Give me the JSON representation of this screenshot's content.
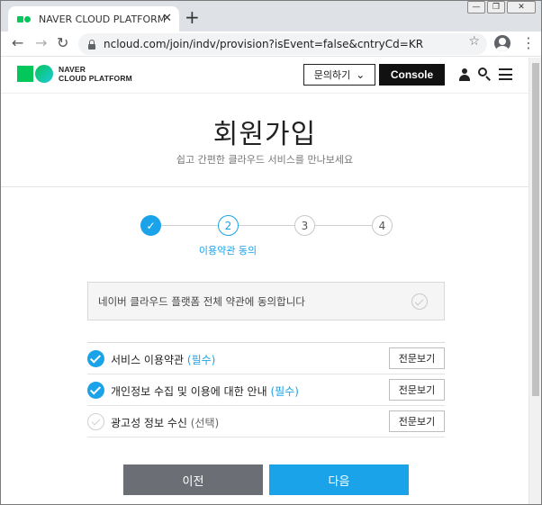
{
  "browser": {
    "tab_title": "NAVER CLOUD PLATFORM 네이",
    "tab_close": "✕",
    "new_tab": "+",
    "url": "ncloud.com/join/indv/provision?isEvent=false&cntryCd=KR",
    "back": "←",
    "forward": "→",
    "reload": "↻",
    "star": "☆",
    "menu": "⋮",
    "window_controls": [
      "—",
      "❐",
      "✕"
    ]
  },
  "header": {
    "logo_line1": "NAVER",
    "logo_line2": "CLOUD PLATFORM",
    "inquiry_label": "문의하기",
    "inquiry_chevron": "⌄",
    "console_label": "Console"
  },
  "page": {
    "title": "회원가입",
    "subtitle": "쉽고 간편한 클라우드 서비스를 만나보세요"
  },
  "stepper": {
    "steps": [
      {
        "label": "✓",
        "state": "done"
      },
      {
        "label": "2",
        "state": "active"
      },
      {
        "label": "3",
        "state": "todo"
      },
      {
        "label": "4",
        "state": "todo"
      }
    ],
    "current_step_label": "이용약관 동의"
  },
  "agree_all": {
    "label": "네이버 클라우드 플랫폼 전체 약관에 동의합니다",
    "checked": false
  },
  "terms": [
    {
      "label": "서비스 이용약관 ",
      "tag": "(필수)",
      "required": true,
      "checked": true,
      "view_label": "전문보기"
    },
    {
      "label": "개인정보 수집 및 이용에 대한 안내 ",
      "tag": "(필수)",
      "required": true,
      "checked": true,
      "view_label": "전문보기"
    },
    {
      "label": "광고성 정보 수신 ",
      "tag": "(선택)",
      "required": false,
      "checked": false,
      "view_label": "전문보기"
    }
  ],
  "actions": {
    "prev_label": "이전",
    "next_label": "다음"
  },
  "colors": {
    "accent": "#1aa3e8",
    "brand_green": "#03c75a",
    "prev_button": "#6b6f75",
    "console_button": "#111111"
  }
}
